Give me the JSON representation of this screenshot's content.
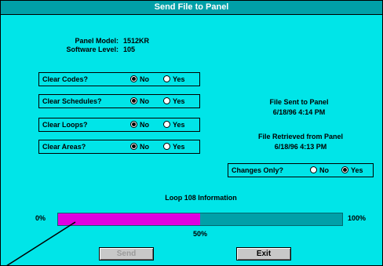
{
  "window": {
    "title": "Send File to Panel"
  },
  "panel_info": {
    "model_label": "Panel Model:",
    "model_value": "1512KR",
    "software_label": "Software Level:",
    "software_value": "105"
  },
  "options": [
    {
      "question": "Clear Codes?",
      "no": "No",
      "yes": "Yes",
      "selected": "no"
    },
    {
      "question": "Clear Schedules?",
      "no": "No",
      "yes": "Yes",
      "selected": "no"
    },
    {
      "question": "Clear Loops?",
      "no": "No",
      "yes": "Yes",
      "selected": "no"
    },
    {
      "question": "Clear Areas?",
      "no": "No",
      "yes": "Yes",
      "selected": "no"
    }
  ],
  "sent": {
    "label": "File Sent to Panel",
    "datetime": "6/18/96 4:14 PM"
  },
  "retrieved": {
    "label": "File Retrieved from Panel",
    "datetime": "6/18/96 4:13 PM"
  },
  "changes_only": {
    "question": "Changes Only?",
    "no": "No",
    "yes": "Yes",
    "selected": "yes"
  },
  "progress": {
    "caption": "Loop 108 Information",
    "min_label": "0%",
    "max_label": "100%",
    "value_label": "50%",
    "value": 0.5,
    "fill_color": "#e000e0"
  },
  "buttons": {
    "send": "Send",
    "exit": "Exit"
  }
}
